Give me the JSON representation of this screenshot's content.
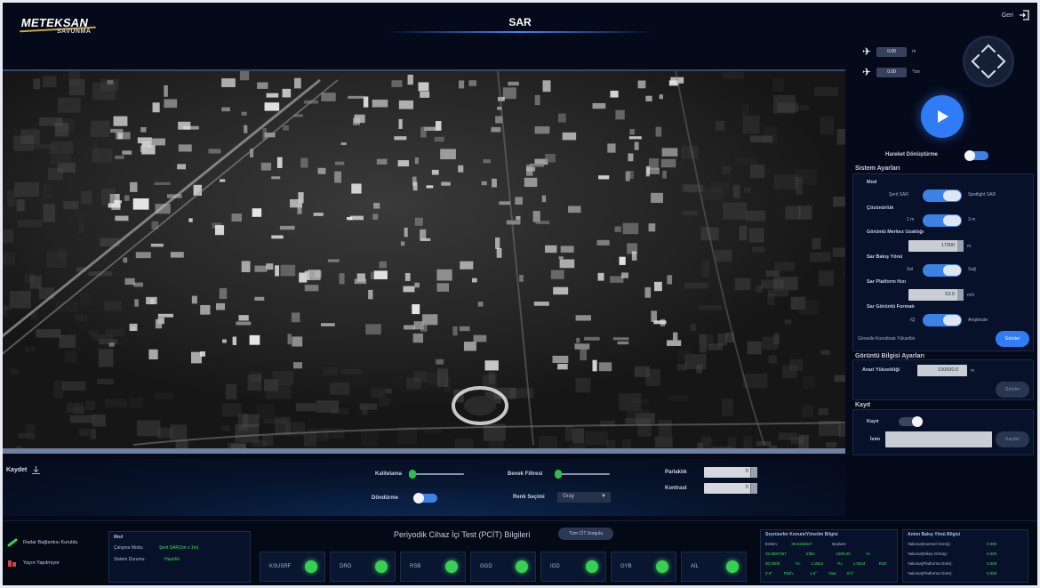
{
  "header": {
    "logo_text": "METEKSAN",
    "logo_sub": "SAVUNMA",
    "title": "SAR",
    "exit_label": "Geri"
  },
  "flight": {
    "row1_value": "0.00",
    "row1_unit": "m",
    "row2_value": "0.00",
    "row2_unit": "°/sn"
  },
  "motion": {
    "label": "Hareket Dönüştürme"
  },
  "system": {
    "title": "Sistem Ayarları",
    "mode_label": "Mod",
    "mode_left": "Şerit SAR",
    "mode_right": "Spotlight SAR",
    "resolution_label": "Çözünürlük",
    "resolution_left": "1 m",
    "resolution_right": "3 m",
    "center_label": "Görüntü Merkez Uzaklığı",
    "center_value": "17000",
    "center_unit": "m",
    "look_label": "Sar Bakış Yönü",
    "look_left": "Sol",
    "look_right": "Sağ",
    "speed_label": "Sar Platform Hızı",
    "speed_value": "53.0",
    "speed_unit": "m/s",
    "format_label": "Sar Görüntü Formatı",
    "format_left": "IQ",
    "format_right": "Amplitude",
    "footer_text": "Görselle Koordinatı Yükseltin",
    "send_btn": "Gönder"
  },
  "display": {
    "title": "Görüntü Bilgisi Ayarları",
    "height_label": "Arazi Yüksekliği",
    "height_value": "100000.0",
    "height_unit": "m",
    "btn": "Gönder"
  },
  "record": {
    "title": "Kayıt",
    "state_label": "Kayıt",
    "name_label": "İsim",
    "btn": "Kaydet"
  },
  "controls": {
    "save_label": "Kaydet",
    "contrast_label": "Kalitelama",
    "filter_label": "Benek Filtresi",
    "invert_label": "Döndürme",
    "color_label": "Renk Seçimi",
    "color_value": "Gray",
    "brightness_label": "Parlaklık",
    "brightness_value": "0",
    "contrast2_label": "Kontrast",
    "contrast2_value": "0"
  },
  "legend": {
    "item1": "Radar Bağlantısı Kuruldu",
    "item2": "Yayın Yapılmıyor"
  },
  "mode_box": {
    "title": "Mod",
    "row1_label": "Çalışma Modu:",
    "row1_value": "Şerit SAR(1m x 1m)",
    "row2_label": "Sistem Durumu:",
    "row2_value": "Hazırlık"
  },
  "pct": {
    "title": "Periyodik Cihaz İçi Test (PCİT) Bilgileri",
    "button": "Tüm CİT Sorgula",
    "tiles": [
      "KSUSRF",
      "DRO",
      "RSB",
      "GGD",
      "IGD",
      "GYB",
      "AİL"
    ]
  },
  "nav_box": {
    "title": "Seyrüsefer Konum/Yönelim Bilgisi",
    "rows": [
      [
        "Enlem:",
        "39.9334647",
        "Boylam:",
        ""
      ],
      [
        "32.8597457",
        "İrtifa:",
        "1000.00",
        "Yo"
      ],
      [
        "30.0000",
        "Yo:",
        "1.0024",
        "Yu:",
        "1.0044",
        "Roll:"
      ],
      [
        "0.0°",
        "Pitch:",
        "1.0°",
        "Yaw:",
        "0.0°"
      ]
    ]
  },
  "beam_box": {
    "title": "Anten Bakış Yönü Bilgisi",
    "rows": [
      [
        "Yakınsa(Karesel Görüş):",
        "0.000"
      ],
      [
        "Yakınsa(Dikey Görüş):",
        "0.000"
      ],
      [
        "Yakınsa(Platforma Göre):",
        "0.000"
      ],
      [
        "Yakınsa(Platforma Göre):",
        "0.000"
      ]
    ]
  }
}
